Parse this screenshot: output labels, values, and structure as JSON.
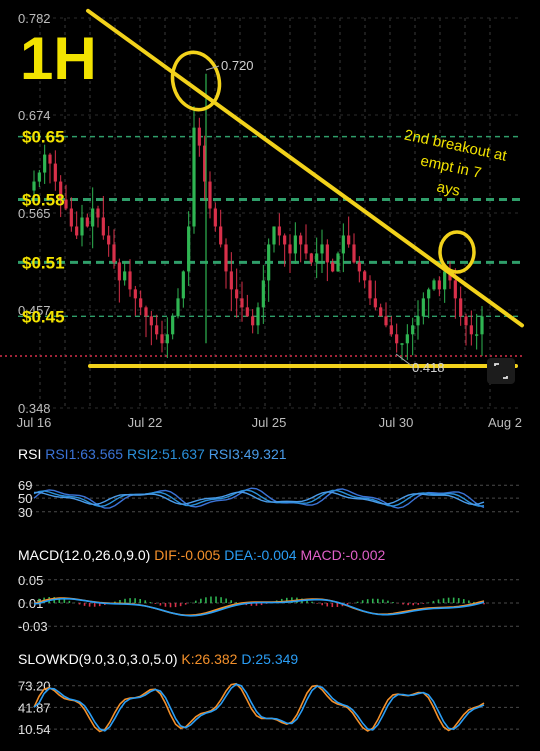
{
  "chart_data": [
    {
      "type": "candlestick",
      "timeframe_label": "1H",
      "x_tick_labels": [
        "Jul 16",
        "Jul 22",
        "Jul 25",
        "Jul 30",
        "Aug 2"
      ],
      "y_tick_labels": [
        "0.782",
        "0.674",
        "0.565",
        "0.457",
        "0.348"
      ],
      "ylim": [
        0.348,
        0.782
      ],
      "high_marker": "0.720",
      "low_marker": "0.418",
      "support_levels": [
        "$0.65",
        "$0.58",
        "$0.51",
        "$0.45"
      ],
      "annotation": "2nd breakout attempt in 7 days",
      "trendline_from": [
        0,
        0.79
      ],
      "trendline_to": [
        1,
        0.44
      ],
      "baseline_level": 0.4,
      "close_series": [
        0.6,
        0.61,
        0.63,
        0.62,
        0.6,
        0.58,
        0.57,
        0.55,
        0.54,
        0.56,
        0.55,
        0.57,
        0.56,
        0.54,
        0.53,
        0.51,
        0.49,
        0.5,
        0.48,
        0.47,
        0.46,
        0.45,
        0.44,
        0.43,
        0.42,
        0.43,
        0.45,
        0.47,
        0.5,
        0.55,
        0.66,
        0.64,
        0.6,
        0.57,
        0.55,
        0.53,
        0.5,
        0.48,
        0.47,
        0.46,
        0.45,
        0.44,
        0.46,
        0.49,
        0.53,
        0.55,
        0.54,
        0.53,
        0.52,
        0.54,
        0.53,
        0.52,
        0.51,
        0.52,
        0.53,
        0.51,
        0.5,
        0.52,
        0.54,
        0.53,
        0.51,
        0.5,
        0.49,
        0.47,
        0.46,
        0.45,
        0.44,
        0.43,
        0.42,
        0.42,
        0.43,
        0.44,
        0.45,
        0.47,
        0.48,
        0.49,
        0.48,
        0.5,
        0.49,
        0.47,
        0.45,
        0.44,
        0.43,
        0.43,
        0.45
      ]
    },
    {
      "type": "line",
      "title": "RSI",
      "series": [
        {
          "name": "RSI1:63.565",
          "color": "#3b73d6"
        },
        {
          "name": "RSI2:51.637",
          "color": "#2a8fd9"
        },
        {
          "name": "RSI3:49.321",
          "color": "#4a9be8"
        }
      ],
      "y_tick_labels": [
        "69",
        "50",
        "30"
      ],
      "ylim": [
        18,
        81
      ]
    },
    {
      "type": "bar",
      "title": "MACD(12.0,26.0,9.0)",
      "series": [
        {
          "name": "DIF:-0.005",
          "color": "#f3902b"
        },
        {
          "name": "DEA:-0.004",
          "color": "#2a9df4"
        },
        {
          "name": "MACD:-0.002",
          "color": "#e060c8"
        }
      ],
      "y_tick_labels": [
        "0.05",
        "0.01",
        "-0.03"
      ],
      "ylim": [
        -0.04,
        0.06
      ]
    },
    {
      "type": "line",
      "title": "SLOWKD(9.0,3.0,3.0,5.0)",
      "series": [
        {
          "name": "K:26.382",
          "color": "#f3902b"
        },
        {
          "name": "D:25.349",
          "color": "#2a9df4"
        }
      ],
      "y_tick_labels": [
        "73.20",
        "41.87",
        "10.54"
      ],
      "ylim": [
        5,
        80
      ]
    }
  ]
}
